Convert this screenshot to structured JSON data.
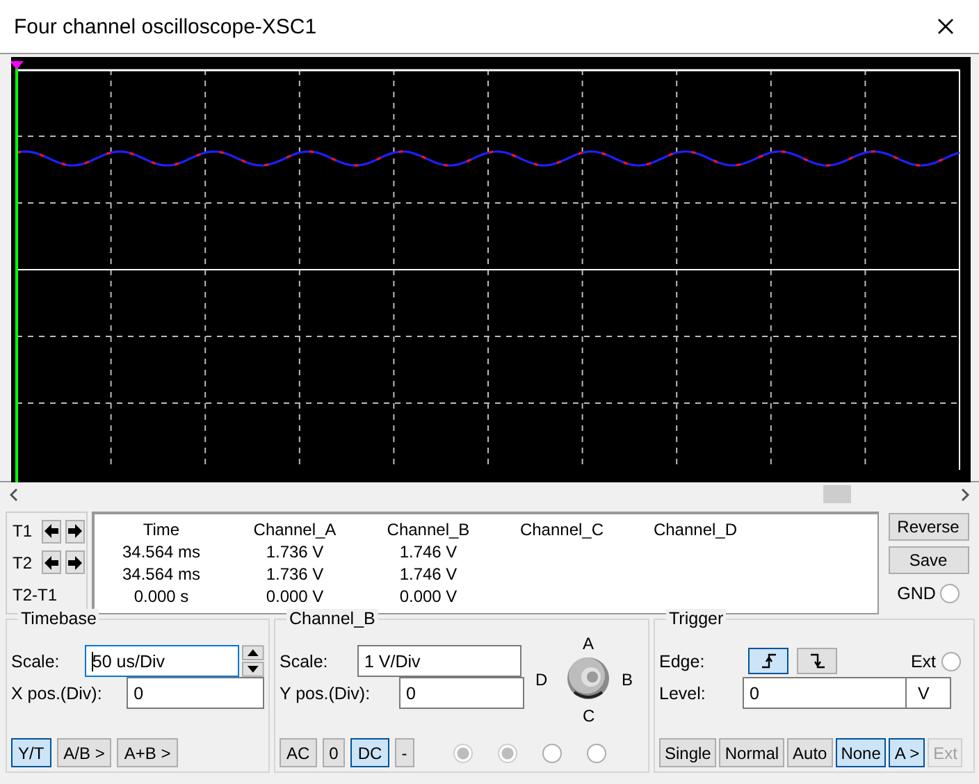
{
  "window": {
    "title": "Four channel oscilloscope-XSC1"
  },
  "readout": {
    "cursors": [
      {
        "label": "T1",
        "kind": "arrows"
      },
      {
        "label": "T2",
        "kind": "arrows"
      },
      {
        "label": "T2-T1",
        "kind": "plain"
      }
    ],
    "columns": [
      "Time",
      "Channel_A",
      "Channel_B",
      "Channel_C",
      "Channel_D"
    ],
    "rows": [
      [
        "34.564 ms",
        "1.736 V",
        "1.746 V"
      ],
      [
        "34.564 ms",
        "1.736 V",
        "1.746 V"
      ],
      [
        "0.000 s",
        "0.000 V",
        "0.000 V"
      ]
    ]
  },
  "side_buttons": [
    "Reverse",
    "Save"
  ],
  "gnd": {
    "label": "GND",
    "checked": false
  },
  "timebase": {
    "title": "Timebase",
    "scale_label": "Scale:",
    "scale": "50 us/Div",
    "xpos_label": "X pos.(Div):",
    "xpos": "0",
    "modes": [
      {
        "label": "Y/T",
        "selected": true
      },
      {
        "label": "A/B >",
        "selected": false
      },
      {
        "label": "A+B >",
        "selected": false
      }
    ]
  },
  "channel": {
    "title": "Channel_B",
    "scale_label": "Scale:",
    "scale": "1  V/Div",
    "ypos_label": "Y pos.(Div):",
    "ypos": "0",
    "selector_labels": [
      "A",
      "D",
      "B",
      "C"
    ],
    "coupling": [
      {
        "label": "AC",
        "selected": false
      },
      {
        "label": "0",
        "selected": false
      },
      {
        "label": "DC",
        "selected": true
      },
      {
        "label": "-",
        "selected": false
      }
    ],
    "radios": [
      {
        "selected": true
      },
      {
        "selected": true
      },
      {
        "selected": false
      },
      {
        "selected": false
      }
    ]
  },
  "trigger": {
    "title": "Trigger",
    "edge_label": "Edge:",
    "edges": [
      {
        "kind": "rising",
        "selected": true
      },
      {
        "kind": "falling",
        "selected": false
      }
    ],
    "ext": {
      "label": "Ext",
      "checked": false
    },
    "level_label": "Level:",
    "level": "0",
    "unit": "V",
    "modes": [
      {
        "label": "Single",
        "selected": false,
        "disabled": false
      },
      {
        "label": "Normal",
        "selected": false,
        "disabled": false
      },
      {
        "label": "Auto",
        "selected": false,
        "disabled": false
      },
      {
        "label": "None",
        "selected": true,
        "disabled": false
      },
      {
        "label": "A >",
        "selected": true,
        "disabled": false
      },
      {
        "label": "Ext",
        "selected": false,
        "disabled": true
      }
    ]
  }
}
